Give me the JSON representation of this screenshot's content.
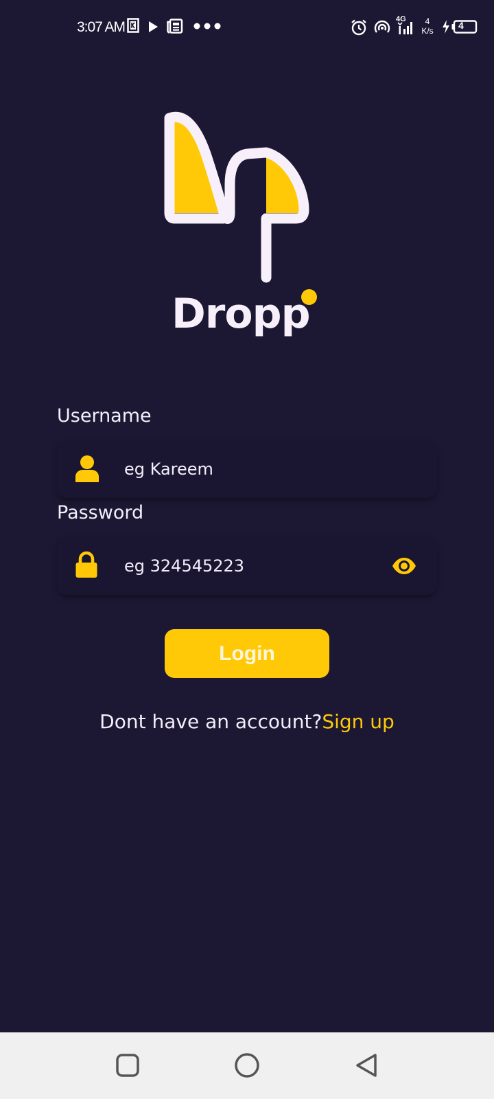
{
  "status_bar": {
    "time": "3:07 AM",
    "net_speed_value": "4",
    "net_speed_unit": "K/s",
    "network_type": "4G",
    "battery_level": "4",
    "icons": [
      "k-app-icon",
      "play-icon",
      "news-icon",
      "more-dots-icon",
      "alarm-icon",
      "hotspot-icon",
      "signal-icon",
      "charging-icon",
      "battery-icon"
    ]
  },
  "app": {
    "name": "Dropp",
    "accent_color": "#ffc907",
    "background_color": "#1c1834"
  },
  "form": {
    "username": {
      "label": "Username",
      "placeholder": "eg Kareem",
      "icon": "user-icon"
    },
    "password": {
      "label": "Password",
      "placeholder": "eg 324545223",
      "icon": "lock-icon",
      "toggle_icon": "eye-icon"
    },
    "login_label": "Login",
    "signup_prompt": "Dont have an account?",
    "signup_link": "Sign up"
  },
  "nav_bar": {
    "icons": [
      "recent-apps-icon",
      "home-icon",
      "back-icon"
    ]
  }
}
